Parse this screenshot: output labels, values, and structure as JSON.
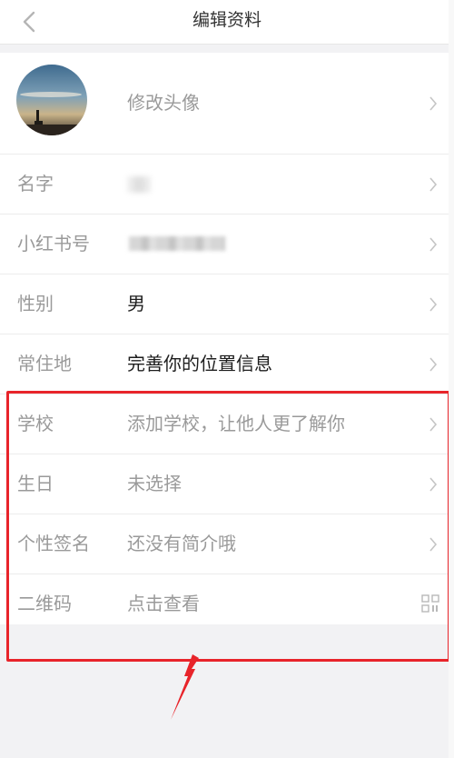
{
  "header": {
    "title": "编辑资料"
  },
  "avatar_row": {
    "label": "修改头像"
  },
  "rows": [
    {
      "label": "名字",
      "value": ""
    },
    {
      "label": "小红书号",
      "value": ""
    },
    {
      "label": "性别",
      "value": "男"
    },
    {
      "label": "常住地",
      "value": "完善你的位置信息"
    },
    {
      "label": "学校",
      "value": "添加学校，让他人更了解你"
    },
    {
      "label": "生日",
      "value": "未选择"
    },
    {
      "label": "个性签名",
      "value": "还没有简介哦"
    },
    {
      "label": "二维码",
      "value": "点击查看"
    }
  ],
  "icons": {
    "back": "chevron-left-icon",
    "row_arrow": "chevron-right-icon",
    "qr": "qr-code-icon"
  },
  "colors": {
    "annotation": "#e8242a",
    "label": "#9a9a9a",
    "value_dark": "#1d1d1d"
  }
}
